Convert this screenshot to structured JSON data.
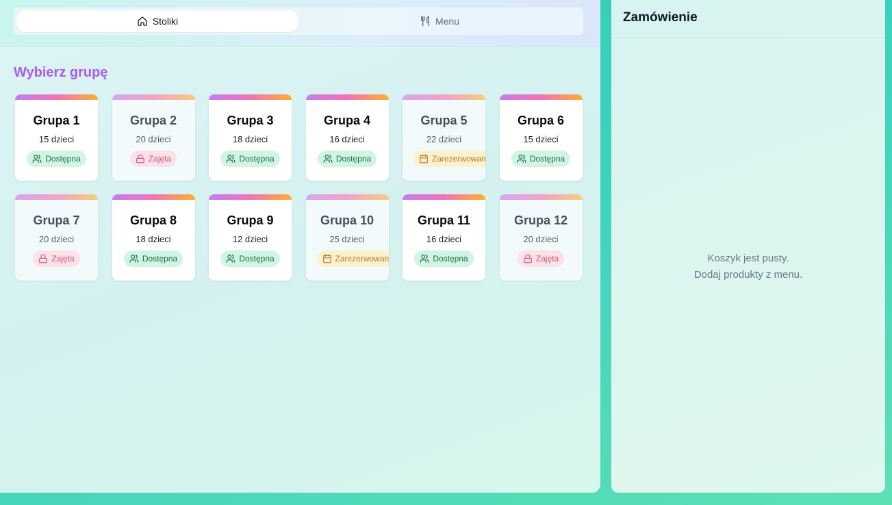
{
  "tabs": [
    {
      "label": "Stoliki",
      "icon": "home-icon",
      "active": true
    },
    {
      "label": "Menu",
      "icon": "utensils-icon",
      "active": false
    }
  ],
  "section_title": "Wybierz grupę",
  "groups": [
    {
      "name": "Grupa 1",
      "count": "15 dzieci",
      "status": "Dostępna",
      "status_type": "available"
    },
    {
      "name": "Grupa 2",
      "count": "20 dzieci",
      "status": "Zajęta",
      "status_type": "occupied"
    },
    {
      "name": "Grupa 3",
      "count": "18 dzieci",
      "status": "Dostępna",
      "status_type": "available"
    },
    {
      "name": "Grupa 4",
      "count": "16 dzieci",
      "status": "Dostępna",
      "status_type": "available"
    },
    {
      "name": "Grupa 5",
      "count": "22 dzieci",
      "status": "Zarezerwowana",
      "status_type": "reserved"
    },
    {
      "name": "Grupa 6",
      "count": "15 dzieci",
      "status": "Dostępna",
      "status_type": "available"
    },
    {
      "name": "Grupa 7",
      "count": "20 dzieci",
      "status": "Zajęta",
      "status_type": "occupied"
    },
    {
      "name": "Grupa 8",
      "count": "18 dzieci",
      "status": "Dostępna",
      "status_type": "available"
    },
    {
      "name": "Grupa 9",
      "count": "12 dzieci",
      "status": "Dostępna",
      "status_type": "available"
    },
    {
      "name": "Grupa 10",
      "count": "25 dzieci",
      "status": "Zarezerwowana",
      "status_type": "reserved"
    },
    {
      "name": "Grupa 11",
      "count": "16 dzieci",
      "status": "Dostępna",
      "status_type": "available"
    },
    {
      "name": "Grupa 12",
      "count": "20 dzieci",
      "status": "Zajęta",
      "status_type": "occupied"
    }
  ],
  "order": {
    "title": "Zamówienie",
    "empty_line1": "Koszyk jest pusty.",
    "empty_line2": "Dodaj produkty z menu."
  },
  "colors": {
    "accent_title": "#a85cf0",
    "available": "#16704a",
    "occupied": "#c85472",
    "reserved": "#b9782c"
  }
}
